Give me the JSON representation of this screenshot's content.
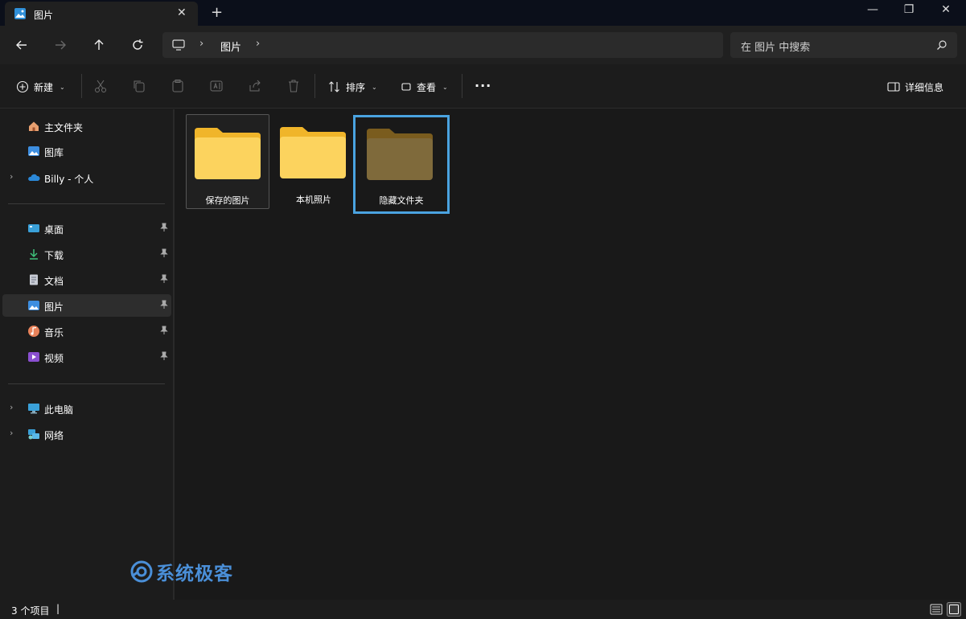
{
  "tab": {
    "title": "图片",
    "close": "✕",
    "new_tab": "+"
  },
  "window": {
    "minimize": "—",
    "maximize": "❐",
    "close": "✕"
  },
  "address": {
    "location": "图片",
    "sep": "›"
  },
  "search": {
    "placeholder": "在 图片 中搜索"
  },
  "commandbar": {
    "new_label": "新建",
    "sort_label": "排序",
    "view_label": "查看",
    "more": "···",
    "details_label": "详细信息"
  },
  "sidebar": {
    "top": [
      {
        "label": "主文件夹"
      },
      {
        "label": "图库"
      },
      {
        "label": "Billy - 个人"
      }
    ],
    "quick": [
      {
        "label": "桌面"
      },
      {
        "label": "下载"
      },
      {
        "label": "文档"
      },
      {
        "label": "图片"
      },
      {
        "label": "音乐"
      },
      {
        "label": "视频"
      }
    ],
    "bottom": [
      {
        "label": "此电脑"
      },
      {
        "label": "网络"
      }
    ]
  },
  "folders": [
    {
      "name": "保存的图片"
    },
    {
      "name": "本机照片"
    },
    {
      "name": "隐藏文件夹"
    }
  ],
  "watermark": "系统极客",
  "status": {
    "count": "3 个项目",
    "caret": "|"
  },
  "colors": {
    "accent": "#4aa3e0",
    "folder": "#f7c948",
    "hidden_folder": "#7a6637"
  }
}
